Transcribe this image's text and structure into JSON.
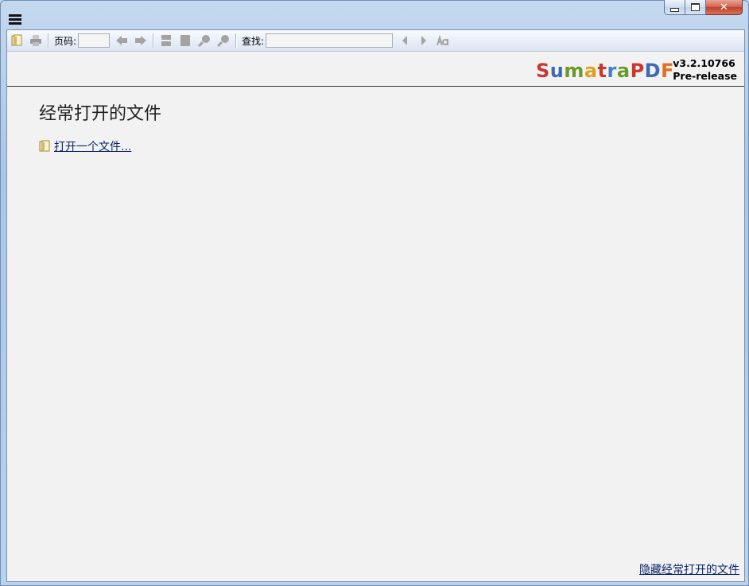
{
  "window": {
    "caption_buttons": {
      "minimize": "minimize-icon",
      "maximize": "maximize-icon",
      "close": "close-icon"
    }
  },
  "toolbar": {
    "page_label": "页码:",
    "page_value": "",
    "find_label": "查找:",
    "find_value": "",
    "icons": [
      "open-icon",
      "print-icon",
      "back-icon",
      "forward-icon",
      "fit-page-icon",
      "fit-width-icon",
      "zoom-out-icon",
      "zoom-in-icon",
      "find-prev-icon",
      "find-next-icon",
      "match-case-icon"
    ]
  },
  "banner": {
    "logo_text": "SumatraPDF",
    "logo_colors": [
      "#c8382c",
      "#3c6ab4",
      "#6a9a2c",
      "#e0a020",
      "#c8382c",
      "#4080c0",
      "#6a9a2c",
      "#c8382c",
      "#3c6ab4",
      "#e07020"
    ],
    "version": "v3.2.10766",
    "channel": "Pre-release"
  },
  "main": {
    "heading": "经常打开的文件",
    "open_file_link": "打开一个文件...",
    "hide_link": "隐藏经常打开的文件"
  },
  "colors": {
    "link": "#0a246a",
    "background": "#f2f2f2"
  }
}
